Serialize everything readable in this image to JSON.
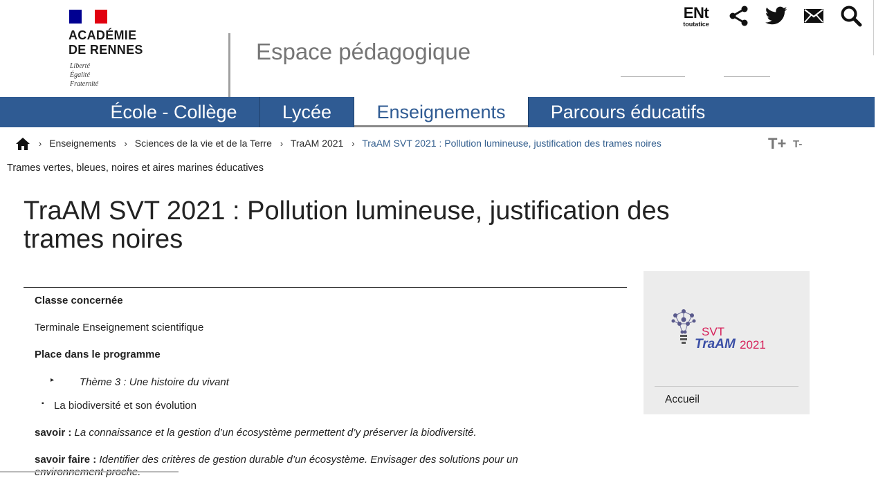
{
  "brand": {
    "academy_line1": "ACADÉMIE",
    "academy_line2": "DE RENNES",
    "motto": [
      "Liberté",
      "Égalité",
      "Fraternité"
    ],
    "site_title": "Espace pédagogique",
    "flag_colors": [
      "#000091",
      "#ffffff",
      "#e1000f"
    ]
  },
  "toolbar": {
    "ent_big": "ENt",
    "ent_small": "toutatice",
    "icons": [
      "share-icon",
      "twitter-icon",
      "mail-icon",
      "search-icon"
    ]
  },
  "nav": {
    "items": [
      "École - Collège",
      "Lycée",
      "Enseignements",
      "Parcours éducatifs"
    ],
    "active_index": 2,
    "bar_color": "#2f5b93"
  },
  "breadcrumb": {
    "items": [
      "Enseignements",
      "Sciences de la vie et de la Terre",
      "TraAM 2021"
    ],
    "current": "TraAM SVT 2021 : Pollution lumineuse, justification des trames noires"
  },
  "text_size": {
    "increase": "T+",
    "decrease": "T-"
  },
  "rubrique": "Trames vertes, bleues, noires et aires marines éducatives",
  "article": {
    "title": "TraAM SVT 2021 : Pollution lumineuse, justification des trames noires",
    "classe_label": "Classe concernée",
    "classe_value": "Terminale Enseignement scientifique",
    "programme_label": "Place dans le programme",
    "theme": "Thème 3 : Une histoire du vivant",
    "bullet": "La biodiversité et son évolution",
    "savoir_label": "savoir :",
    "savoir_text": "La connaissance et la gestion d’un écosystème permettent d’y préserver la biodiversité.",
    "savoir_faire_label": "savoir faire :",
    "savoir_faire_text": "Identifier des critères de gestion durable d’un écosystème. Envisager des solutions pour un",
    "savoir_faire_text2": "environnement proche."
  },
  "aside": {
    "logo_svt": "SVT",
    "logo_traam": "TraAM",
    "logo_year": "2021",
    "link": "Accueil"
  }
}
